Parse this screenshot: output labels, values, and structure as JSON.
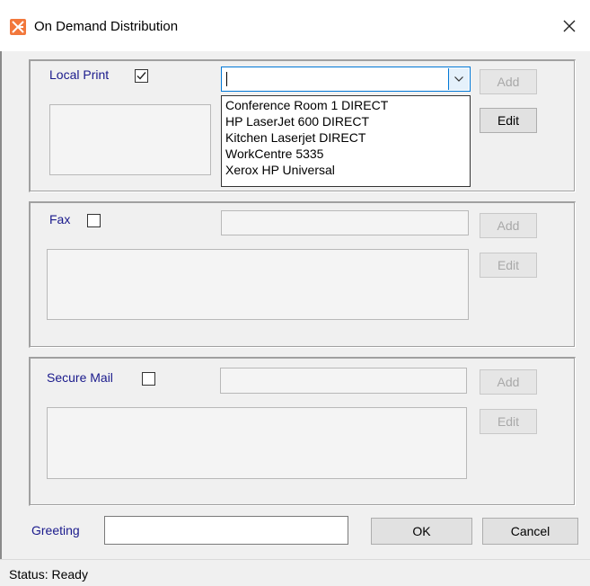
{
  "window": {
    "title": "On Demand Distribution",
    "icon": "app-logo-icon",
    "close_icon": "close-icon"
  },
  "local_print": {
    "label": "Local Print",
    "checked": true,
    "combo_value": "",
    "dropdown_options": [
      "Conference Room 1 DIRECT",
      "HP LaserJet 600 DIRECT",
      "Kitchen Laserjet DIRECT",
      "WorkCentre 5335",
      "Xerox HP Universal"
    ],
    "add_label": "Add",
    "edit_label": "Edit"
  },
  "fax": {
    "label": "Fax",
    "checked": false,
    "add_label": "Add",
    "edit_label": "Edit"
  },
  "secure_mail": {
    "label": "Secure Mail",
    "checked": false,
    "add_label": "Add",
    "edit_label": "Edit"
  },
  "footer": {
    "greeting_label": "Greeting",
    "greeting_value": "",
    "ok_label": "OK",
    "cancel_label": "Cancel"
  },
  "status": {
    "text": "Status: Ready"
  },
  "colors": {
    "label_blue": "#1a1a8c",
    "focus_blue": "#0078d7",
    "icon_orange": "#f2783c"
  }
}
